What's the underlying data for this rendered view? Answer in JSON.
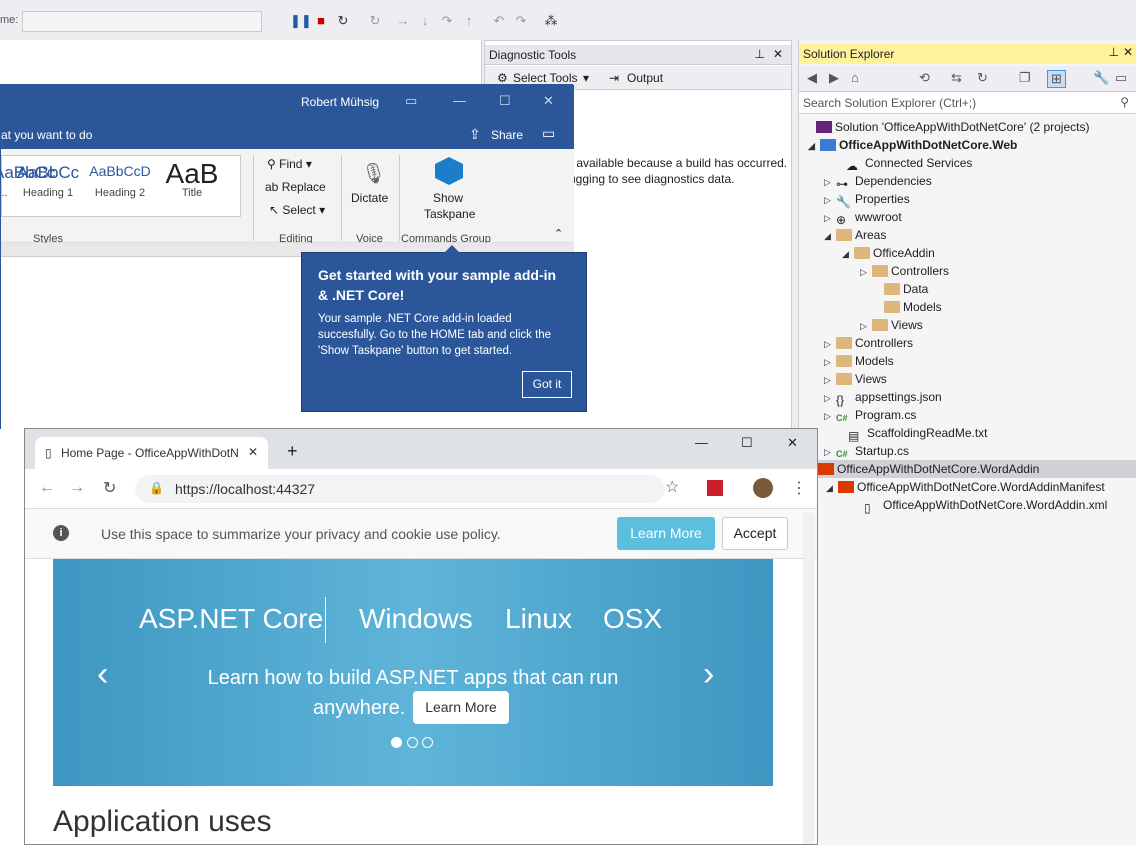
{
  "vs": {
    "toolbar_label": "me:",
    "diagnostic": {
      "title": "Diagnostic Tools",
      "select_tools": "Select Tools",
      "output": "Output",
      "message_line1": "r available because a build has occurred.",
      "message_line2": "ugging to see diagnostics data."
    },
    "solution_explorer": {
      "title": "Solution Explorer",
      "search_placeholder": "Search Solution Explorer (Ctrl+;)",
      "nodes": [
        {
          "label": "Solution 'OfficeAppWithDotNetCore' (2 projects)"
        },
        {
          "label": "OfficeAppWithDotNetCore.Web"
        },
        {
          "label": "Connected Services"
        },
        {
          "label": "Dependencies"
        },
        {
          "label": "Properties"
        },
        {
          "label": "wwwroot"
        },
        {
          "label": "Areas"
        },
        {
          "label": "OfficeAddin"
        },
        {
          "label": "Controllers"
        },
        {
          "label": "Data"
        },
        {
          "label": "Models"
        },
        {
          "label": "Views"
        },
        {
          "label": "Controllers"
        },
        {
          "label": "Models"
        },
        {
          "label": "Views"
        },
        {
          "label": "appsettings.json"
        },
        {
          "label": "Program.cs"
        },
        {
          "label": "ScaffoldingReadMe.txt"
        },
        {
          "label": "Startup.cs"
        },
        {
          "label": "OfficeAppWithDotNetCore.WordAddin"
        },
        {
          "label": "OfficeAppWithDotNetCore.WordAddinManifest"
        },
        {
          "label": "OfficeAppWithDotNetCore.WordAddin.xml"
        }
      ]
    }
  },
  "word": {
    "user": "Robert Mühsig",
    "tell_me": "at you want to do",
    "share": "Share",
    "styles": [
      {
        "preview": "AaBbCc",
        "name": "..."
      },
      {
        "preview": "AaBbCc",
        "name": "Heading 1"
      },
      {
        "preview": "AaBbCcD",
        "name": "Heading 2"
      },
      {
        "preview": "AaB",
        "name": "Title"
      }
    ],
    "groups": {
      "styles": "Styles",
      "editing": "Editing",
      "voice": "Voice",
      "commands": "Commands Group"
    },
    "find": "Find",
    "replace": "Replace",
    "select": "Select",
    "dictate": "Dictate",
    "show_taskpane_1": "Show",
    "show_taskpane_2": "Taskpane"
  },
  "callout": {
    "title": "Get started with your sample add-in & .NET Core!",
    "body": "Your sample .NET Core add-in loaded succesfully. Go to the HOME tab and click the 'Show Taskpane' button to get started.",
    "button": "Got it"
  },
  "chrome": {
    "tab_title": "Home Page - OfficeAppWithDotN",
    "url": "https://localhost:44327",
    "cookie_text": "Use this space to summarize your privacy and cookie use policy.",
    "learn_more": "Learn More",
    "accept": "Accept",
    "carousel": {
      "items": [
        "ASP.NET Core",
        "Windows",
        "Linux",
        "OSX"
      ],
      "caption_line1": "Learn how to build ASP.NET apps that can run",
      "caption_line2": "anywhere.",
      "button": "Learn More"
    },
    "heading": "Application uses"
  }
}
